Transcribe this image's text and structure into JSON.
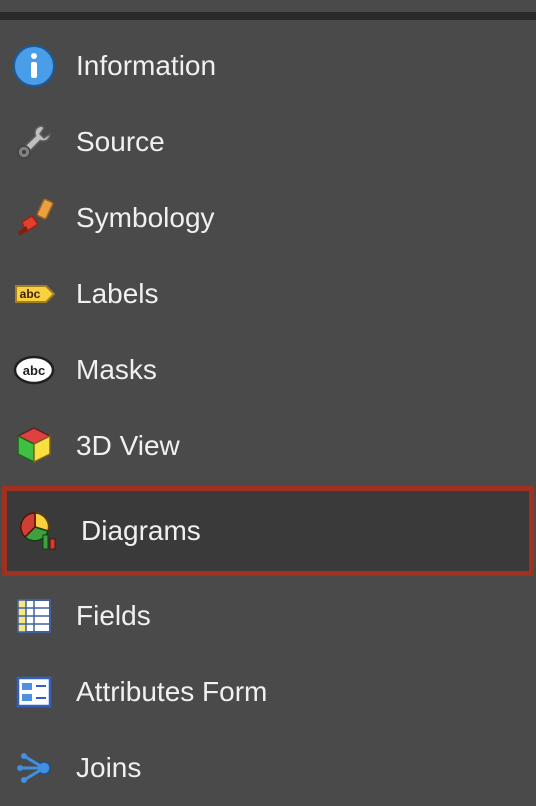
{
  "sidebar": {
    "items": [
      {
        "label": "Information",
        "icon": "info-icon",
        "highlighted": false
      },
      {
        "label": "Source",
        "icon": "wrench-icon",
        "highlighted": false
      },
      {
        "label": "Symbology",
        "icon": "paintbrush-icon",
        "highlighted": false
      },
      {
        "label": "Labels",
        "icon": "label-tag-icon",
        "highlighted": false
      },
      {
        "label": "Masks",
        "icon": "mask-icon",
        "highlighted": false
      },
      {
        "label": "3D View",
        "icon": "cube-icon",
        "highlighted": false
      },
      {
        "label": "Diagrams",
        "icon": "pie-chart-icon",
        "highlighted": true
      },
      {
        "label": "Fields",
        "icon": "fields-icon",
        "highlighted": false
      },
      {
        "label": "Attributes Form",
        "icon": "form-icon",
        "highlighted": false
      },
      {
        "label": "Joins",
        "icon": "join-icon",
        "highlighted": false
      }
    ]
  }
}
